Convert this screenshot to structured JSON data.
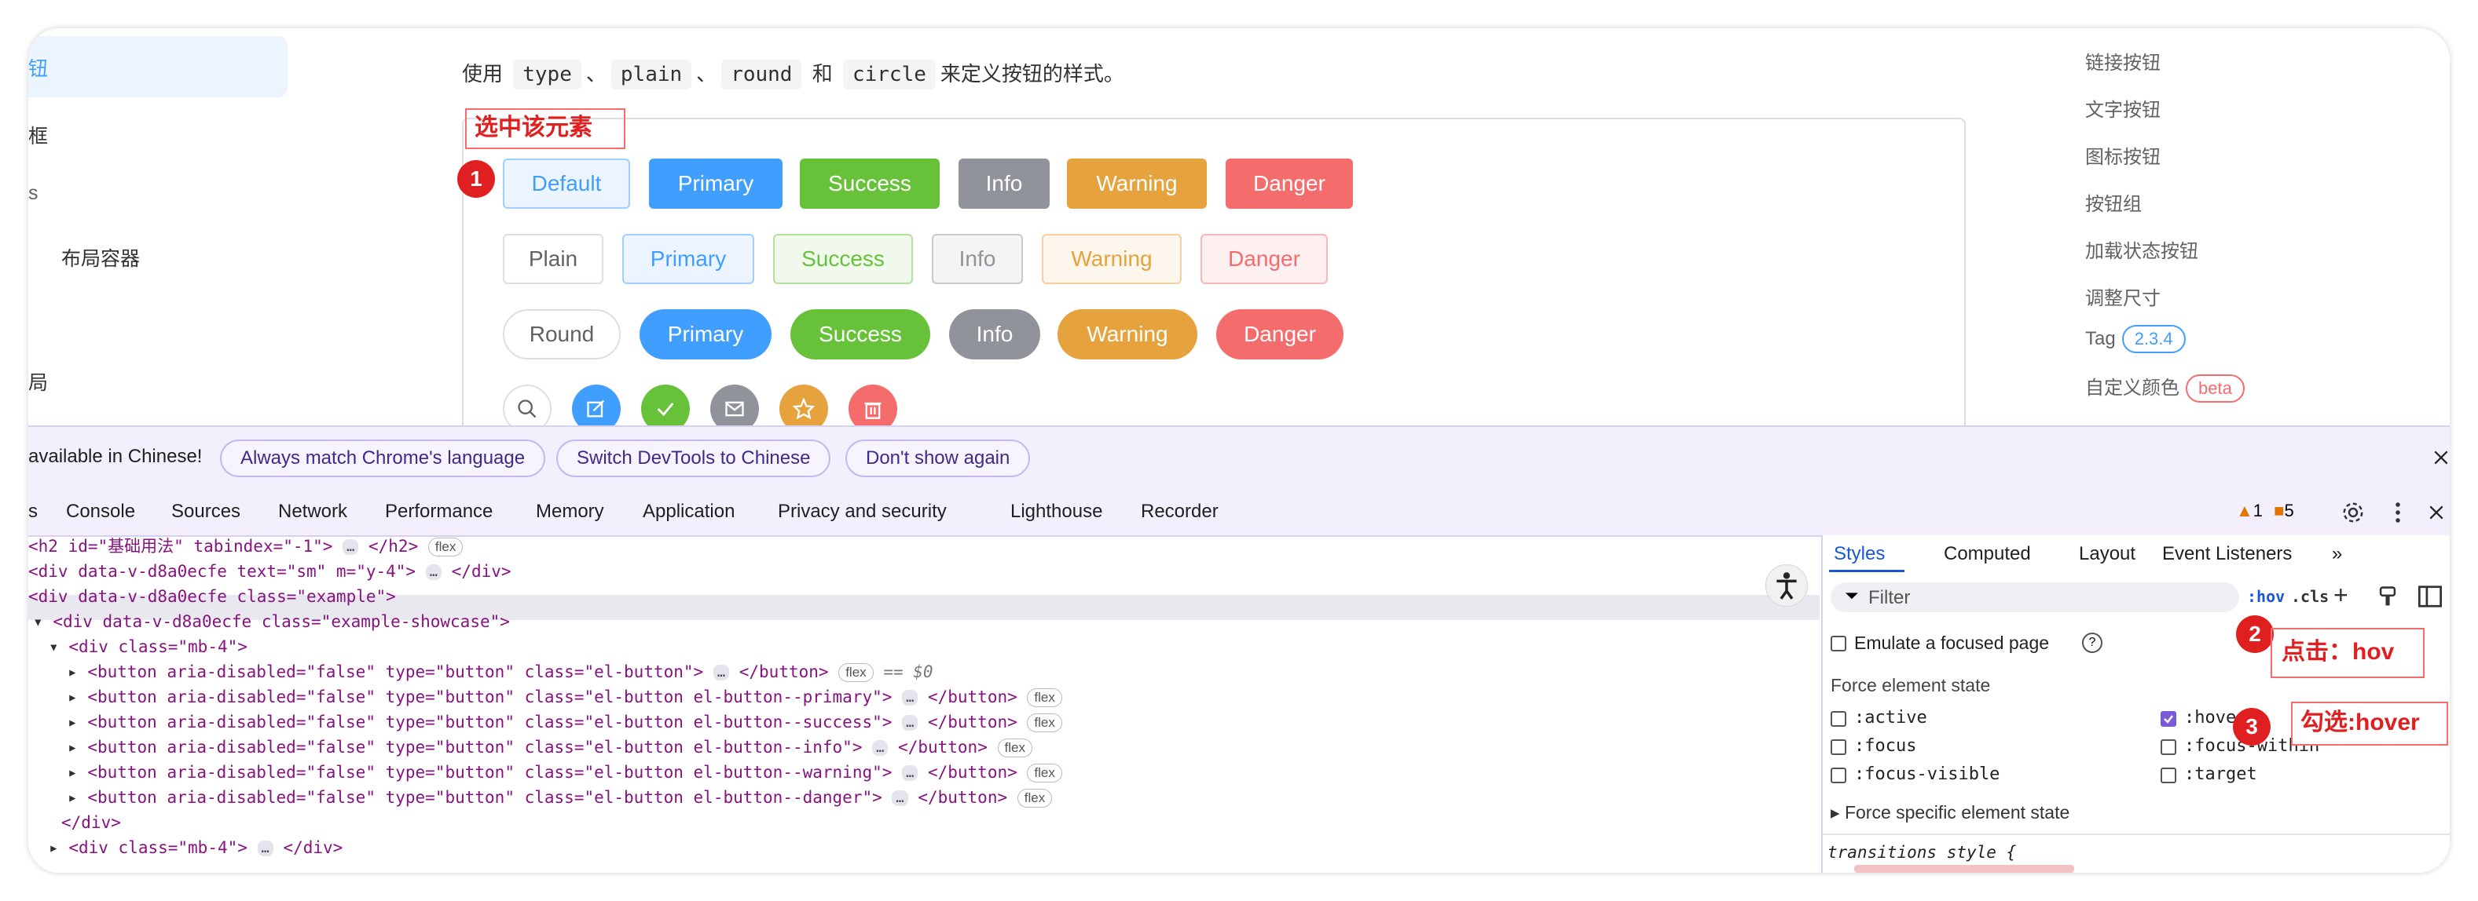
{
  "sidebar": {
    "active": "钮",
    "items": [
      "框",
      "s",
      "布局容器",
      "局"
    ]
  },
  "intro": {
    "prefix": "使用",
    "code1": "type",
    "sep1": "、",
    "code2": "plain",
    "sep2": "、",
    "code3": "round",
    "and": "和",
    "code4": "circle",
    "suffix": "来定义按钮的样式。"
  },
  "annotations": {
    "select_element": "选中该元素",
    "step1": "1",
    "step2": "2",
    "click_hov": "点击：hov",
    "step3": "3",
    "check_hover": "勾选:hover"
  },
  "buttons": {
    "row1": [
      "Default",
      "Primary",
      "Success",
      "Info",
      "Warning",
      "Danger"
    ],
    "row2": [
      "Plain",
      "Primary",
      "Success",
      "Info",
      "Warning",
      "Danger"
    ],
    "row3": [
      "Round",
      "Primary",
      "Success",
      "Info",
      "Warning",
      "Danger"
    ],
    "circle_icons": [
      "search-icon",
      "edit-icon",
      "check-icon",
      "message-icon",
      "star-icon",
      "delete-icon"
    ]
  },
  "colors": {
    "primary": "#409eff",
    "success": "#67c23a",
    "info": "#909399",
    "warning": "#e6a23c",
    "danger": "#f56c6c",
    "annotation": "#e02020",
    "devtools_accent": "#7a5ad8"
  },
  "toc": {
    "items": [
      "链接按钮",
      "文字按钮",
      "图标按钮",
      "按钮组",
      "加载状态按钮",
      "调整尺寸"
    ],
    "tag_label": "Tag",
    "tag_badge": "2.3.4",
    "custom_color_label": "自定义颜色",
    "custom_color_badge": "beta"
  },
  "devtools": {
    "banner": {
      "text": "available in Chinese!",
      "match_language": "Always match Chrome's language",
      "switch_chinese": "Switch DevTools to Chinese",
      "dont_show": "Don't show again"
    },
    "tabs": [
      "s",
      "Console",
      "Sources",
      "Network",
      "Performance",
      "Memory",
      "Application",
      "Privacy and security",
      "Lighthouse",
      "Recorder"
    ],
    "warnings_count": "1",
    "issues_count": "5",
    "elements": {
      "h2_text": "<h2 id=\"基础用法\" tabindex=\"-1\">",
      "h2_close": "</h2>",
      "div_sm": "<div data-v-d8a0ecfe text=\"sm\" m=\"y-4\">",
      "div_example": "<div data-v-d8a0ecfe class=\"example\">",
      "div_showcase": "<div data-v-d8a0ecfe class=\"example-showcase\">",
      "div_mb4": "<div class=\"mb-4\">",
      "btn_default": "<button aria-disabled=\"false\" type=\"button\" class=\"el-button\">",
      "selected_marker": "== $0",
      "btn_primary": "<button aria-disabled=\"false\" type=\"button\" class=\"el-button el-button--primary\">",
      "btn_success": "<button aria-disabled=\"false\" type=\"button\" class=\"el-button el-button--success\">",
      "btn_info": "<button aria-disabled=\"false\" type=\"button\" class=\"el-button el-button--info\">",
      "btn_warning": "<button aria-disabled=\"false\" type=\"button\" class=\"el-button el-button--warning\">",
      "btn_danger": "<button aria-disabled=\"false\" type=\"button\" class=\"el-button el-button--danger\">",
      "btn_close": "</button>",
      "div_close": "</div>",
      "div_mb4_collapsed": "<div class=\"mb-4\">",
      "div_mb4_collapsed_close": "</div>",
      "flex": "flex",
      "dots": "…"
    },
    "styles": {
      "tabs": [
        "Styles",
        "Computed",
        "Layout",
        "Event Listeners"
      ],
      "filter_placeholder": "Filter",
      "hov": ":hov",
      "cls": ".cls",
      "emulate_focus": "Emulate a focused page",
      "force_state": "Force element state",
      "states_left": [
        ":active",
        ":focus",
        ":focus-visible"
      ],
      "states_right": [
        ":hover",
        ":focus-within",
        ":target"
      ],
      "force_specific": "Force specific element state",
      "transitions": "transitions style {"
    }
  }
}
